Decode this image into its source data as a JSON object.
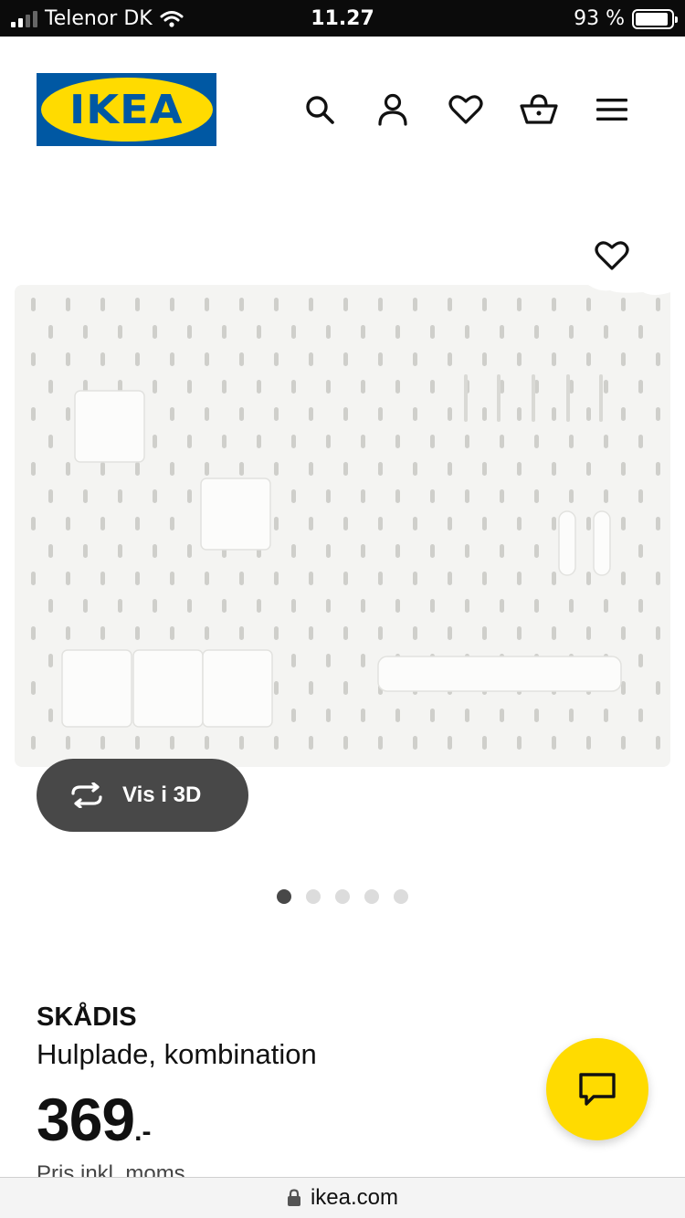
{
  "status_bar": {
    "carrier": "Telenor DK",
    "time": "11.27",
    "battery": "93 %",
    "battery_level": 0.93
  },
  "header": {
    "logo_text": "IKEA",
    "icons": [
      "search-icon",
      "account-icon",
      "favourites-icon",
      "basket-icon",
      "menu-icon"
    ]
  },
  "product": {
    "name": "SKÅDIS",
    "description": "Hulplade, kombination",
    "price": "369",
    "price_suffix": ".-",
    "vat_note": "Pris inkl. moms"
  },
  "gallery": {
    "view_3d_label": "Vis i 3D",
    "image_count": 5,
    "active_index": 0
  },
  "browser": {
    "url": "ikea.com"
  },
  "colors": {
    "brand_blue": "#0058a3",
    "brand_yellow": "#ffdb00",
    "dark_button": "#484848",
    "dot_inactive": "#dcdcdc"
  }
}
